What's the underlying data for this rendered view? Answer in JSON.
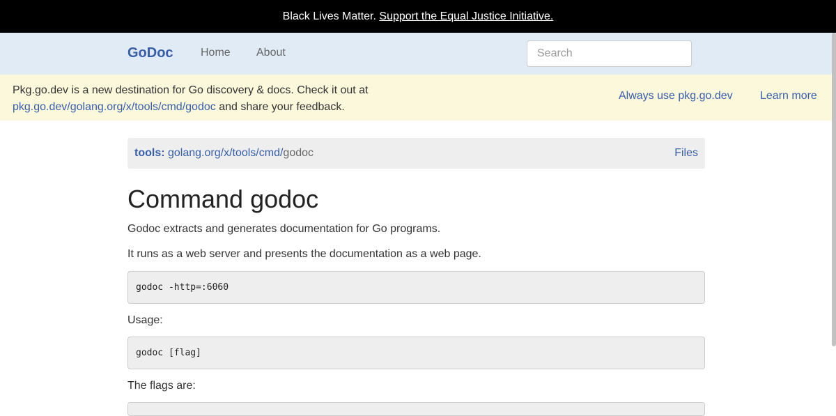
{
  "banner": {
    "text": "Black Lives Matter.",
    "link": "Support the Equal Justice Initiative."
  },
  "navbar": {
    "brand": "GoDoc",
    "links": [
      "Home",
      "About"
    ],
    "search_placeholder": "Search"
  },
  "notice": {
    "line1": "Pkg.go.dev is a new destination for Go discovery & docs. Check it out at",
    "link": "pkg.go.dev/golang.org/x/tools/cmd/godoc",
    "line2_suffix": " and share your feedback.",
    "actions": [
      "Always use pkg.go.dev",
      "Learn more"
    ]
  },
  "pathbar": {
    "repo": "tools:",
    "segment1": "golang.org/x/tools/",
    "segment2": "cmd/",
    "current": "godoc",
    "files": "Files"
  },
  "main": {
    "title": "Command godoc",
    "intro": "Godoc extracts and generates documentation for Go programs.",
    "desc": "It runs as a web server and presents the documentation as a web page.",
    "code1": "godoc -http=:6060",
    "usage_label": "Usage:",
    "code2": "godoc [flag]",
    "flags_label": "The flags are:"
  },
  "colors": {
    "link": "#375eab",
    "navbar_bg": "#e0ebf5",
    "notice_bg": "#fcf8dc",
    "banner_bg": "#000000"
  }
}
